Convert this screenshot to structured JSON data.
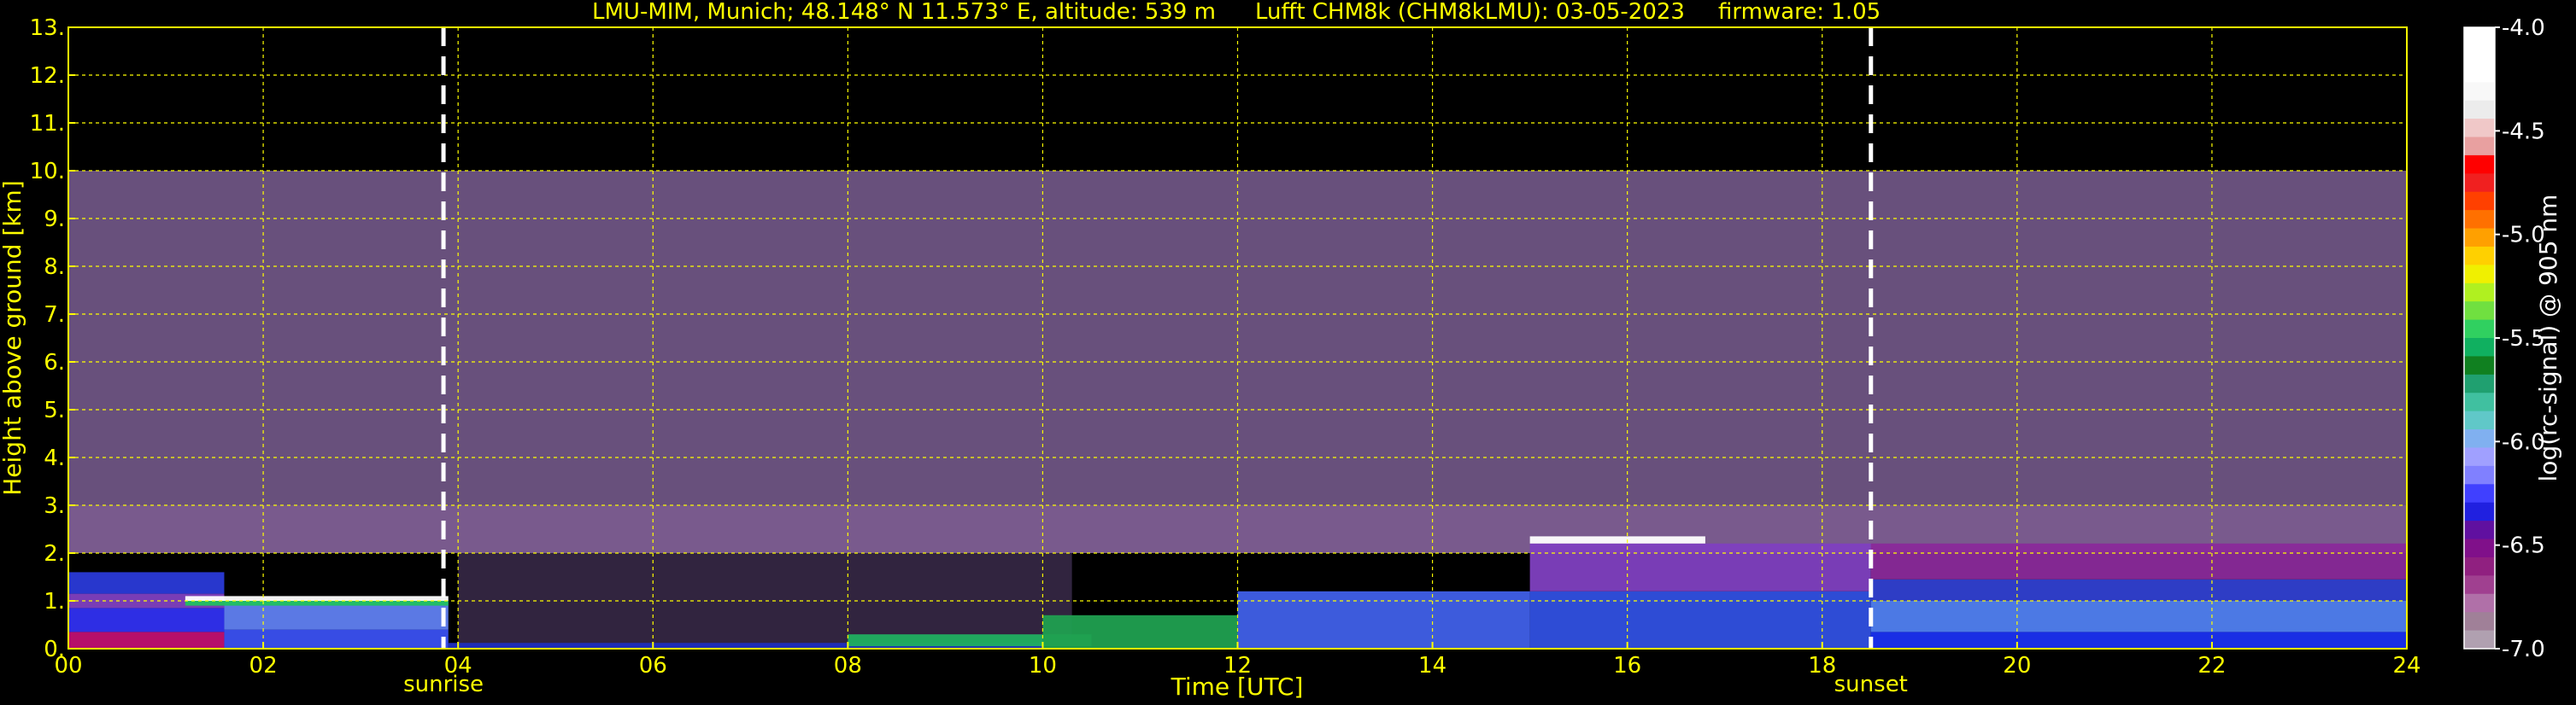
{
  "chart_data": {
    "type": "heatmap",
    "title": {
      "station": "LMU-MIM, Munich; 48.148° N 11.573° E, altitude: 539 m",
      "instrument": "Lufft CHM8k (CHM8kLMU): 03-05-2023",
      "firmware": "firmware: 1.05"
    },
    "xlabel": "Time [UTC]",
    "ylabel": "Height above ground [km]",
    "xlim": [
      0,
      24
    ],
    "ylim": [
      0,
      13
    ],
    "x_ticks": [
      {
        "value": 0,
        "label": "00"
      },
      {
        "value": 2,
        "label": "02"
      },
      {
        "value": 4,
        "label": "04"
      },
      {
        "value": 6,
        "label": "06"
      },
      {
        "value": 8,
        "label": "08"
      },
      {
        "value": 10,
        "label": "10"
      },
      {
        "value": 12,
        "label": "12"
      },
      {
        "value": 14,
        "label": "14"
      },
      {
        "value": 16,
        "label": "16"
      },
      {
        "value": 18,
        "label": "18"
      },
      {
        "value": 20,
        "label": "20"
      },
      {
        "value": 22,
        "label": "22"
      },
      {
        "value": 24,
        "label": "24"
      }
    ],
    "y_ticks": [
      {
        "value": 0,
        "label": "0."
      },
      {
        "value": 1,
        "label": "1."
      },
      {
        "value": 2,
        "label": "2."
      },
      {
        "value": 3,
        "label": "3."
      },
      {
        "value": 4,
        "label": "4."
      },
      {
        "value": 5,
        "label": "5."
      },
      {
        "value": 6,
        "label": "6."
      },
      {
        "value": 7,
        "label": "7."
      },
      {
        "value": 8,
        "label": "8."
      },
      {
        "value": 9,
        "label": "9."
      },
      {
        "value": 10,
        "label": "10."
      },
      {
        "value": 11,
        "label": "11."
      },
      {
        "value": 12,
        "label": "12."
      },
      {
        "value": 13,
        "label": "13."
      }
    ],
    "grid": true,
    "grid_color": "#ffff00",
    "data_top_km": 10,
    "markers": [
      {
        "name": "sunrise",
        "time": 3.85
      },
      {
        "name": "sunset",
        "time": 18.5
      }
    ],
    "colorbar": {
      "label": "log(rc-signal) @ 905 nm",
      "range": [
        -7.0,
        -4.0
      ],
      "ticks": [
        {
          "value": -4.0,
          "label": "-4.0"
        },
        {
          "value": -4.5,
          "label": "-4.5"
        },
        {
          "value": -5.0,
          "label": "-5.0"
        },
        {
          "value": -5.5,
          "label": "-5.5"
        },
        {
          "value": -6.0,
          "label": "-6.0"
        },
        {
          "value": -6.5,
          "label": "-6.5"
        },
        {
          "value": -7.0,
          "label": "-7.0"
        }
      ],
      "colors_top_to_bottom": [
        "#ffffff",
        "#ffffff",
        "#ffffff",
        "#f8f8f8",
        "#ececec",
        "#f0c8c8",
        "#e8a0a0",
        "#ff0000",
        "#f02020",
        "#ff4000",
        "#ff7000",
        "#ffa000",
        "#ffd000",
        "#f0f000",
        "#b0f020",
        "#70e040",
        "#30d060",
        "#10b060",
        "#108020",
        "#20a070",
        "#40c0a0",
        "#60c8c8",
        "#80b0f0",
        "#a0a0ff",
        "#8080ff",
        "#4040ff",
        "#2020e0",
        "#6010a0",
        "#80108a",
        "#902080",
        "#a04090",
        "#b070a8",
        "#a08098",
        "#b0a0b0"
      ]
    },
    "layers": [
      {
        "kind": "noise",
        "time": [
          0,
          24
        ],
        "height": [
          3.0,
          10.0
        ],
        "color": "#7a5e92"
      },
      {
        "kind": "noise",
        "time": [
          0,
          24
        ],
        "height": [
          2.0,
          3.0
        ],
        "color": "#8e6aa6"
      },
      {
        "kind": "noise",
        "time": [
          4.0,
          10.3
        ],
        "height": [
          0.1,
          2.0
        ],
        "color": "#3a2a4a"
      },
      {
        "kind": "aerosol",
        "time": [
          0,
          1.6
        ],
        "height": [
          0.0,
          0.35
        ],
        "color": "#c01070"
      },
      {
        "kind": "aerosol",
        "time": [
          0,
          1.6
        ],
        "height": [
          0.35,
          0.85
        ],
        "color": "#3030f0"
      },
      {
        "kind": "aerosol",
        "time": [
          0,
          1.6
        ],
        "height": [
          0.85,
          1.15
        ],
        "color": "#8040c0"
      },
      {
        "kind": "aerosol",
        "time": [
          0,
          1.6
        ],
        "height": [
          1.15,
          1.6
        ],
        "color": "#2a3ad8"
      },
      {
        "kind": "aerosol",
        "time": [
          1.6,
          3.9
        ],
        "height": [
          0.0,
          0.4
        ],
        "color": "#3a50f0"
      },
      {
        "kind": "aerosol",
        "time": [
          1.6,
          3.9
        ],
        "height": [
          0.4,
          1.0
        ],
        "color": "#6080f0"
      },
      {
        "kind": "aerosol",
        "time": [
          1.2,
          3.9
        ],
        "height": [
          0.9,
          1.0
        ],
        "color": "#20c060"
      },
      {
        "kind": "aerosol",
        "time": [
          1.2,
          3.9
        ],
        "height": [
          1.0,
          1.1
        ],
        "color": "#ffffff"
      },
      {
        "kind": "aerosol",
        "time": [
          3.9,
          10.0
        ],
        "height": [
          0.0,
          0.12
        ],
        "color": "#2030c0"
      },
      {
        "kind": "aerosol",
        "time": [
          8.0,
          10.5
        ],
        "height": [
          0.05,
          0.3
        ],
        "color": "#20b060"
      },
      {
        "kind": "aerosol",
        "time": [
          10.0,
          12.0
        ],
        "height": [
          0.0,
          0.7
        ],
        "color": "#20a050"
      },
      {
        "kind": "aerosol",
        "time": [
          12.0,
          15.0
        ],
        "height": [
          0.0,
          1.2
        ],
        "color": "#4060e8"
      },
      {
        "kind": "aerosol",
        "time": [
          15.0,
          18.5
        ],
        "height": [
          0.0,
          1.2
        ],
        "color": "#3050e0"
      },
      {
        "kind": "aerosol",
        "time": [
          15.0,
          18.5
        ],
        "height": [
          1.2,
          2.2
        ],
        "color": "#8040c0"
      },
      {
        "kind": "aerosol",
        "time": [
          15.0,
          16.8
        ],
        "height": [
          2.2,
          2.35
        ],
        "color": "#ffffff"
      },
      {
        "kind": "aerosol",
        "time": [
          18.5,
          24.0
        ],
        "height": [
          0.0,
          0.35
        ],
        "color": "#1a30f0"
      },
      {
        "kind": "aerosol",
        "time": [
          18.5,
          24.0
        ],
        "height": [
          0.35,
          1.0
        ],
        "color": "#5080f0"
      },
      {
        "kind": "aerosol",
        "time": [
          18.5,
          24.0
        ],
        "height": [
          1.0,
          1.45
        ],
        "color": "#3040d0"
      },
      {
        "kind": "aerosol",
        "time": [
          18.5,
          24.0
        ],
        "height": [
          1.45,
          2.2
        ],
        "color": "#8a2a9a"
      }
    ]
  }
}
